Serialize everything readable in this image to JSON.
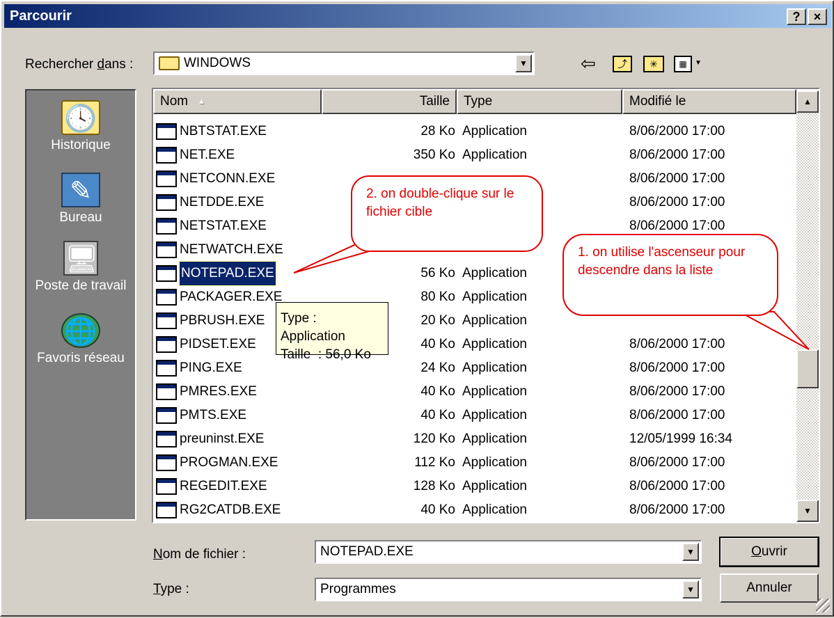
{
  "window": {
    "title": "Parcourir",
    "help_label": "?",
    "close_label": "×"
  },
  "lookin": {
    "label_prefix": "Rechercher ",
    "label_underlined": "d",
    "label_suffix": "ans :",
    "value": "WINDOWS"
  },
  "toolbar": {
    "back_icon": "back-arrow-icon",
    "up_icon": "up-folder-icon",
    "new_folder_icon": "new-folder-icon",
    "view_icon": "view-menu-icon"
  },
  "places": [
    {
      "label": "Historique",
      "icon": "history-icon"
    },
    {
      "label": "Bureau",
      "icon": "desktop-icon"
    },
    {
      "label": "Poste de travail",
      "icon": "my-computer-icon"
    },
    {
      "label": "Favoris réseau",
      "icon": "network-places-icon"
    }
  ],
  "columns": {
    "name": "Nom",
    "sort_indicator": "▲",
    "size": "Taille",
    "type": "Type",
    "modified": "Modifié le"
  },
  "files": [
    {
      "name": "NBTSTAT.EXE",
      "size": "28 Ko",
      "type": "Application",
      "modified": "8/06/2000 17:00"
    },
    {
      "name": "NET.EXE",
      "size": "350 Ko",
      "type": "Application",
      "modified": "8/06/2000 17:00"
    },
    {
      "name": "NETCONN.EXE",
      "size": "",
      "type": "",
      "modified": "8/06/2000 17:00"
    },
    {
      "name": "NETDDE.EXE",
      "size": "",
      "type": "",
      "modified": "8/06/2000 17:00"
    },
    {
      "name": "NETSTAT.EXE",
      "size": "",
      "type": "",
      "modified": "8/06/2000 17:00"
    },
    {
      "name": "NETWATCH.EXE",
      "size": "",
      "type": "",
      "modified": ""
    },
    {
      "name": "NOTEPAD.EXE",
      "size": "56 Ko",
      "type": "Application",
      "modified": ""
    },
    {
      "name": "PACKAGER.EXE",
      "size": "80 Ko",
      "type": "Application",
      "modified": ""
    },
    {
      "name": "PBRUSH.EXE",
      "size": "20 Ko",
      "type": "Application",
      "modified": ""
    },
    {
      "name": "PIDSET.EXE",
      "size": "40 Ko",
      "type": "Application",
      "modified": "8/06/2000 17:00"
    },
    {
      "name": "PING.EXE",
      "size": "24 Ko",
      "type": "Application",
      "modified": "8/06/2000 17:00"
    },
    {
      "name": "PMRES.EXE",
      "size": "40 Ko",
      "type": "Application",
      "modified": "8/06/2000 17:00"
    },
    {
      "name": "PMTS.EXE",
      "size": "40 Ko",
      "type": "Application",
      "modified": "8/06/2000 17:00"
    },
    {
      "name": "preuninst.EXE",
      "size": "120 Ko",
      "type": "Application",
      "modified": "12/05/1999 16:34"
    },
    {
      "name": "PROGMAN.EXE",
      "size": "112 Ko",
      "type": "Application",
      "modified": "8/06/2000 17:00"
    },
    {
      "name": "REGEDIT.EXE",
      "size": "128 Ko",
      "type": "Application",
      "modified": "8/06/2000 17:00"
    },
    {
      "name": "RG2CATDB.EXE",
      "size": "40 Ko",
      "type": "Application",
      "modified": "8/06/2000 17:00"
    }
  ],
  "selected_file": "NOTEPAD.EXE",
  "tooltip": {
    "line1": "Type : Application",
    "line2": "Taille  : 56,0 Ko"
  },
  "filename": {
    "label_underlined": "N",
    "label_rest": "om de fichier :",
    "value": "NOTEPAD.EXE"
  },
  "filetype": {
    "label_underlined": "T",
    "label_rest": "ype :",
    "value": "Programmes"
  },
  "buttons": {
    "open_underlined": "O",
    "open_rest": "uvrir",
    "cancel": "Annuler"
  },
  "annotations": {
    "callout1": "1. on utilise l'ascenseur pour descendre dans la liste",
    "callout2": "2. on double-clique sur le fichier cible",
    "color": "#e00000"
  },
  "colors": {
    "titlebar_start": "#0a246a",
    "titlebar_end": "#a6caf0",
    "selection": "#0a246a",
    "face": "#d4d0c8"
  }
}
